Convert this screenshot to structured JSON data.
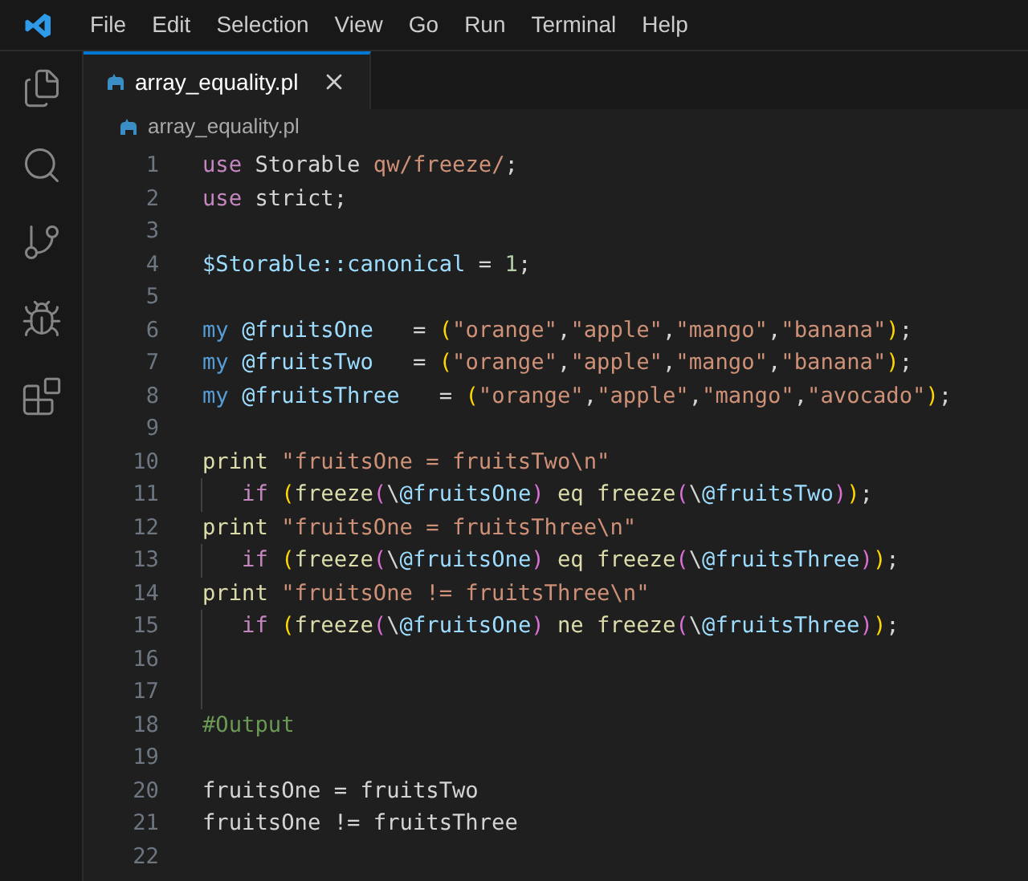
{
  "menu": [
    "File",
    "Edit",
    "Selection",
    "View",
    "Go",
    "Run",
    "Terminal",
    "Help"
  ],
  "activity_bar": [
    {
      "kind": "explorer"
    },
    {
      "kind": "search"
    },
    {
      "kind": "source-control"
    },
    {
      "kind": "run-debug"
    },
    {
      "kind": "extensions"
    }
  ],
  "tabs": [
    {
      "label": "array_equality.pl",
      "selected": true
    }
  ],
  "breadcrumb": "array_equality.pl",
  "lines": [
    {
      "number": "1",
      "guide": false,
      "tokens": [
        {
          "kind": "keyword",
          "text": "use"
        },
        {
          "kind": "plain",
          "text": " Storable "
        },
        {
          "kind": "string",
          "text": "qw/freeze/"
        },
        {
          "kind": "plain",
          "text": ";"
        }
      ]
    },
    {
      "number": "2",
      "guide": false,
      "tokens": [
        {
          "kind": "keyword",
          "text": "use"
        },
        {
          "kind": "plain",
          "text": " strict;"
        }
      ]
    },
    {
      "number": "3",
      "guide": false
    },
    {
      "number": "4",
      "guide": false,
      "tokens": [
        {
          "kind": "variable",
          "text": "$Storable::canonical"
        },
        {
          "kind": "plain",
          "text": " = "
        },
        {
          "kind": "number",
          "text": "1"
        },
        {
          "kind": "plain",
          "text": ";"
        }
      ]
    },
    {
      "number": "5",
      "guide": false
    },
    {
      "number": "6",
      "guide": false,
      "tokens": [
        {
          "kind": "storage",
          "text": "my "
        },
        {
          "kind": "variable",
          "text": "@fruitsOne"
        },
        {
          "kind": "plain",
          "text": "   = "
        },
        {
          "kind": "bracket1",
          "text": "("
        },
        {
          "kind": "string",
          "text": "\"orange\""
        },
        {
          "kind": "plain",
          "text": ","
        },
        {
          "kind": "string",
          "text": "\"apple\""
        },
        {
          "kind": "plain",
          "text": ","
        },
        {
          "kind": "string",
          "text": "\"mango\""
        },
        {
          "kind": "plain",
          "text": ","
        },
        {
          "kind": "string",
          "text": "\"banana\""
        },
        {
          "kind": "bracket1",
          "text": ")"
        },
        {
          "kind": "plain",
          "text": ";"
        }
      ]
    },
    {
      "number": "7",
      "guide": false,
      "tokens": [
        {
          "kind": "storage",
          "text": "my "
        },
        {
          "kind": "variable",
          "text": "@fruitsTwo"
        },
        {
          "kind": "plain",
          "text": "   = "
        },
        {
          "kind": "bracket1",
          "text": "("
        },
        {
          "kind": "string",
          "text": "\"orange\""
        },
        {
          "kind": "plain",
          "text": ","
        },
        {
          "kind": "string",
          "text": "\"apple\""
        },
        {
          "kind": "plain",
          "text": ","
        },
        {
          "kind": "string",
          "text": "\"mango\""
        },
        {
          "kind": "plain",
          "text": ","
        },
        {
          "kind": "string",
          "text": "\"banana\""
        },
        {
          "kind": "bracket1",
          "text": ")"
        },
        {
          "kind": "plain",
          "text": ";"
        }
      ]
    },
    {
      "number": "8",
      "guide": false,
      "tokens": [
        {
          "kind": "storage",
          "text": "my "
        },
        {
          "kind": "variable",
          "text": "@fruitsThree"
        },
        {
          "kind": "plain",
          "text": "   = "
        },
        {
          "kind": "bracket1",
          "text": "("
        },
        {
          "kind": "string",
          "text": "\"orange\""
        },
        {
          "kind": "plain",
          "text": ","
        },
        {
          "kind": "string",
          "text": "\"apple\""
        },
        {
          "kind": "plain",
          "text": ","
        },
        {
          "kind": "string",
          "text": "\"mango\""
        },
        {
          "kind": "plain",
          "text": ","
        },
        {
          "kind": "string",
          "text": "\"avocado\""
        },
        {
          "kind": "bracket1",
          "text": ")"
        },
        {
          "kind": "plain",
          "text": ";"
        }
      ]
    },
    {
      "number": "9",
      "guide": false
    },
    {
      "number": "10",
      "guide": false,
      "tokens": [
        {
          "kind": "function",
          "text": "print "
        },
        {
          "kind": "string",
          "text": "\"fruitsOne = fruitsTwo\\n\""
        }
      ]
    },
    {
      "number": "11",
      "guide": true,
      "tokens": [
        {
          "kind": "keyword",
          "text": "   if "
        },
        {
          "kind": "bracket1",
          "text": "("
        },
        {
          "kind": "function",
          "text": "freeze"
        },
        {
          "kind": "bracket2",
          "text": "("
        },
        {
          "kind": "plain",
          "text": "\\"
        },
        {
          "kind": "variable",
          "text": "@fruitsOne"
        },
        {
          "kind": "bracket2",
          "text": ")"
        },
        {
          "kind": "function",
          "text": " eq freeze"
        },
        {
          "kind": "bracket2",
          "text": "("
        },
        {
          "kind": "plain",
          "text": "\\"
        },
        {
          "kind": "variable",
          "text": "@fruitsTwo"
        },
        {
          "kind": "bracket2",
          "text": ")"
        },
        {
          "kind": "bracket1",
          "text": ")"
        },
        {
          "kind": "plain",
          "text": ";"
        }
      ]
    },
    {
      "number": "12",
      "guide": false,
      "tokens": [
        {
          "kind": "function",
          "text": "print "
        },
        {
          "kind": "string",
          "text": "\"fruitsOne = fruitsThree\\n\""
        }
      ]
    },
    {
      "number": "13",
      "guide": true,
      "tokens": [
        {
          "kind": "keyword",
          "text": "   if "
        },
        {
          "kind": "bracket1",
          "text": "("
        },
        {
          "kind": "function",
          "text": "freeze"
        },
        {
          "kind": "bracket2",
          "text": "("
        },
        {
          "kind": "plain",
          "text": "\\"
        },
        {
          "kind": "variable",
          "text": "@fruitsOne"
        },
        {
          "kind": "bracket2",
          "text": ")"
        },
        {
          "kind": "function",
          "text": " eq freeze"
        },
        {
          "kind": "bracket2",
          "text": "("
        },
        {
          "kind": "plain",
          "text": "\\"
        },
        {
          "kind": "variable",
          "text": "@fruitsThree"
        },
        {
          "kind": "bracket2",
          "text": ")"
        },
        {
          "kind": "bracket1",
          "text": ")"
        },
        {
          "kind": "plain",
          "text": ";"
        }
      ]
    },
    {
      "number": "14",
      "guide": false,
      "tokens": [
        {
          "kind": "function",
          "text": "print "
        },
        {
          "kind": "string",
          "text": "\"fruitsOne != fruitsThree\\n\""
        }
      ]
    },
    {
      "number": "15",
      "guide": true,
      "tokens": [
        {
          "kind": "keyword",
          "text": "   if "
        },
        {
          "kind": "bracket1",
          "text": "("
        },
        {
          "kind": "function",
          "text": "freeze"
        },
        {
          "kind": "bracket2",
          "text": "("
        },
        {
          "kind": "plain",
          "text": "\\"
        },
        {
          "kind": "variable",
          "text": "@fruitsOne"
        },
        {
          "kind": "bracket2",
          "text": ")"
        },
        {
          "kind": "function",
          "text": " ne freeze"
        },
        {
          "kind": "bracket2",
          "text": "("
        },
        {
          "kind": "plain",
          "text": "\\"
        },
        {
          "kind": "variable",
          "text": "@fruitsThree"
        },
        {
          "kind": "bracket2",
          "text": ")"
        },
        {
          "kind": "bracket1",
          "text": ")"
        },
        {
          "kind": "plain",
          "text": ";"
        }
      ]
    },
    {
      "number": "16",
      "guide": true
    },
    {
      "number": "17",
      "guide": true
    },
    {
      "number": "18",
      "guide": false,
      "tokens": [
        {
          "kind": "comment",
          "text": "#Output"
        }
      ]
    },
    {
      "number": "19",
      "guide": false
    },
    {
      "number": "20",
      "guide": false,
      "tokens": [
        {
          "kind": "plain",
          "text": "fruitsOne = fruitsTwo"
        }
      ]
    },
    {
      "number": "21",
      "guide": false,
      "tokens": [
        {
          "kind": "plain",
          "text": "fruitsOne != fruitsThree"
        }
      ]
    },
    {
      "number": "22",
      "guide": false
    }
  ]
}
